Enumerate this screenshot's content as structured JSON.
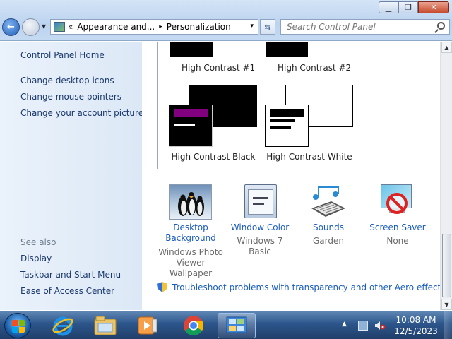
{
  "window": {
    "controls": {
      "minimize": "▁",
      "maximize": "❐",
      "close": "✕"
    }
  },
  "address": {
    "prefix": "«",
    "crumbs": [
      "Appearance and...",
      "Personalization"
    ],
    "separator": "▸",
    "dropdown": "▾"
  },
  "search": {
    "placeholder": "Search Control Panel"
  },
  "sidebar": {
    "home": "Control Panel Home",
    "tasks": [
      "Change desktop icons",
      "Change mouse pointers",
      "Change your account picture"
    ],
    "see_also_label": "See also",
    "see_also": [
      "Display",
      "Taskbar and Start Menu",
      "Ease of Access Center"
    ]
  },
  "themes": [
    {
      "label": "High Contrast #1"
    },
    {
      "label": "High Contrast #2"
    },
    {
      "label": "High Contrast Black",
      "bg": "#000000",
      "accent": "#800080",
      "text": "#ffffff"
    },
    {
      "label": "High Contrast White",
      "bg": "#ffffff",
      "accent": "#000000",
      "text": "#000000"
    }
  ],
  "settings": [
    {
      "title": "Desktop Background",
      "sub": "Windows Photo Viewer Wallpaper",
      "icon": "penguins-wallpaper-icon"
    },
    {
      "title": "Window Color",
      "sub": "Windows 7 Basic",
      "icon": "window-color-icon"
    },
    {
      "title": "Sounds",
      "sub": "Garden",
      "icon": "sounds-icon"
    },
    {
      "title": "Screen Saver",
      "sub": "None",
      "icon": "screen-saver-icon"
    }
  ],
  "troubleshoot": "Troubleshoot problems with transparency and other Aero effects",
  "taskbar": {
    "apps": [
      "internet-explorer-icon",
      "windows-explorer-icon",
      "media-player-icon",
      "chrome-icon",
      "control-panel-icon"
    ],
    "clock_time": "10:08 AM",
    "clock_date": "12/5/2023"
  },
  "colors": {
    "link": "#1a5dbc",
    "sidebar_link": "#1c3a6e",
    "muted": "#6a6a6a"
  }
}
